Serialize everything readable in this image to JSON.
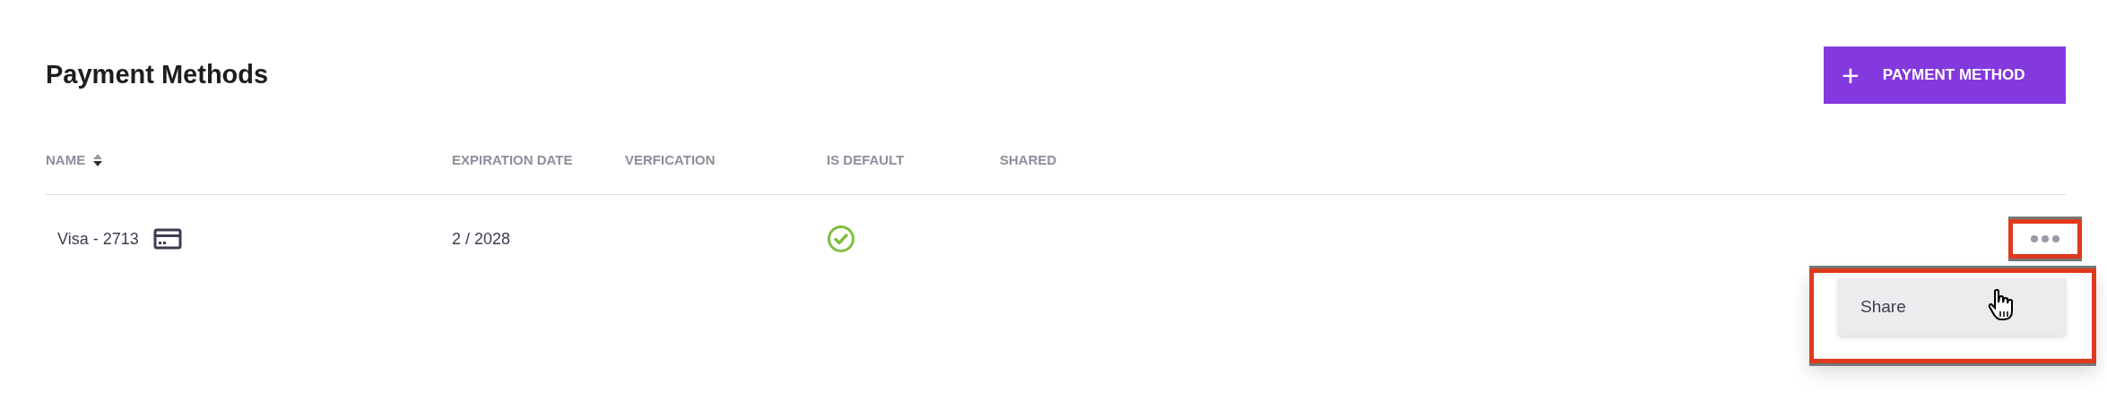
{
  "page": {
    "title": "Payment Methods"
  },
  "add_button": {
    "icon": "+",
    "label": "PAYMENT METHOD"
  },
  "table": {
    "columns": [
      {
        "label": "NAME",
        "sorted": true
      },
      {
        "label": "EXPIRATION DATE",
        "sorted": false
      },
      {
        "label": "VERFICATION",
        "sorted": false
      },
      {
        "label": "IS DEFAULT",
        "sorted": false
      },
      {
        "label": "SHARED",
        "sorted": false
      }
    ],
    "rows": [
      {
        "name": "Visa - 2713",
        "expiration": "2 / 2028",
        "is_default": true,
        "highlighted": true
      }
    ]
  },
  "row_menu": {
    "items": [
      {
        "label": "Share",
        "hovered": true
      }
    ]
  }
}
